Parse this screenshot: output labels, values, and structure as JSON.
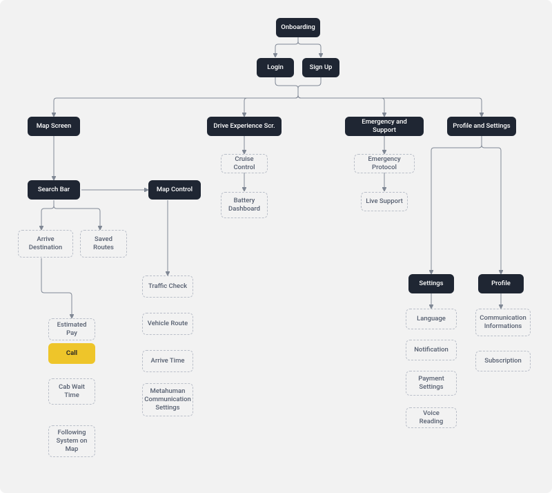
{
  "nodes": {
    "onboarding": "Onboarding",
    "login": "Login",
    "signup": "Sign Up",
    "mapScreen": "Map Screen",
    "driveExp": "Drive Experience Scr.",
    "emergency": "Emergency and Support",
    "profileSettings": "Profile and Settings",
    "cruiseControl": "Cruise Control",
    "batteryDashboard": "Battery Dashboard",
    "emergencyProtocol": "Emergency Protocol",
    "liveSupport": "Live Support",
    "searchBar": "Search Bar",
    "mapControl": "Map Control",
    "arriveDestination": "Arrive Destination",
    "savedRoutes": "Saved Routes",
    "estimatedPay": "Estimated Pay",
    "call": "Call",
    "cabWaitTime": "Cab Wait Time",
    "followingSystem": "Following System on Map",
    "trafficCheck": "Traffic Check",
    "vehicleRoute": "Vehicle Route",
    "arriveTime": "Arrive Time",
    "metahuman": "Metahuman Communication Settings",
    "settings": "Settings",
    "profile": "Profile",
    "language": "Language",
    "notification": "Notification",
    "paymentSettings": "Payment Settings",
    "voiceReading": "Voice Reading",
    "commInfo": "Communication Informations",
    "subscription": "Subscription"
  },
  "chart_data": {
    "type": "tree",
    "title": "",
    "node_styles": {
      "dark": {
        "fill": "#1f2633",
        "text": "#ffffff",
        "dashed": false
      },
      "dashed": {
        "fill": "none",
        "text": "#545d6e",
        "dashed": true
      },
      "yellow": {
        "fill": "#eec52a",
        "text": "#222222",
        "dashed": false
      }
    },
    "nodes": [
      {
        "id": "onboarding",
        "label": "Onboarding",
        "style": "dark"
      },
      {
        "id": "login",
        "label": "Login",
        "style": "dark"
      },
      {
        "id": "signup",
        "label": "Sign Up",
        "style": "dark"
      },
      {
        "id": "mapScreen",
        "label": "Map Screen",
        "style": "dark"
      },
      {
        "id": "driveExp",
        "label": "Drive Experience Scr.",
        "style": "dark"
      },
      {
        "id": "emergency",
        "label": "Emergency and Support",
        "style": "dark"
      },
      {
        "id": "profileSettings",
        "label": "Profile and Settings",
        "style": "dark"
      },
      {
        "id": "searchBar",
        "label": "Search Bar",
        "style": "dark"
      },
      {
        "id": "mapControl",
        "label": "Map Control",
        "style": "dark"
      },
      {
        "id": "settings",
        "label": "Settings",
        "style": "dark"
      },
      {
        "id": "profile",
        "label": "Profile",
        "style": "dark"
      },
      {
        "id": "cruiseControl",
        "label": "Cruise Control",
        "style": "dashed"
      },
      {
        "id": "batteryDashboard",
        "label": "Battery Dashboard",
        "style": "dashed"
      },
      {
        "id": "emergencyProtocol",
        "label": "Emergency Protocol",
        "style": "dashed"
      },
      {
        "id": "liveSupport",
        "label": "Live Support",
        "style": "dashed"
      },
      {
        "id": "arriveDestination",
        "label": "Arrive Destination",
        "style": "dashed"
      },
      {
        "id": "savedRoutes",
        "label": "Saved Routes",
        "style": "dashed"
      },
      {
        "id": "estimatedPay",
        "label": "Estimated Pay",
        "style": "dashed"
      },
      {
        "id": "call",
        "label": "Call",
        "style": "yellow"
      },
      {
        "id": "cabWaitTime",
        "label": "Cab Wait Time",
        "style": "dashed"
      },
      {
        "id": "followingSystem",
        "label": "Following System on Map",
        "style": "dashed"
      },
      {
        "id": "trafficCheck",
        "label": "Traffic Check",
        "style": "dashed"
      },
      {
        "id": "vehicleRoute",
        "label": "Vehicle Route",
        "style": "dashed"
      },
      {
        "id": "arriveTime",
        "label": "Arrive Time",
        "style": "dashed"
      },
      {
        "id": "metahuman",
        "label": "Metahuman Communication Settings",
        "style": "dashed"
      },
      {
        "id": "language",
        "label": "Language",
        "style": "dashed"
      },
      {
        "id": "notification",
        "label": "Notification",
        "style": "dashed"
      },
      {
        "id": "paymentSettings",
        "label": "Payment Settings",
        "style": "dashed"
      },
      {
        "id": "voiceReading",
        "label": "Voice Reading",
        "style": "dashed"
      },
      {
        "id": "commInfo",
        "label": "Communication Informations",
        "style": "dashed"
      },
      {
        "id": "subscription",
        "label": "Subscription",
        "style": "dashed"
      }
    ],
    "edges": [
      [
        "onboarding",
        "login"
      ],
      [
        "onboarding",
        "signup"
      ],
      [
        "login",
        "mapScreen"
      ],
      [
        "login",
        "driveExp"
      ],
      [
        "login",
        "emergency"
      ],
      [
        "login",
        "profileSettings"
      ],
      [
        "signup",
        "mapScreen"
      ],
      [
        "signup",
        "driveExp"
      ],
      [
        "signup",
        "emergency"
      ],
      [
        "signup",
        "profileSettings"
      ],
      [
        "mapScreen",
        "searchBar"
      ],
      [
        "searchBar",
        "mapControl"
      ],
      [
        "searchBar",
        "arriveDestination"
      ],
      [
        "searchBar",
        "savedRoutes"
      ],
      [
        "arriveDestination",
        "estimatedPay"
      ],
      [
        "estimatedPay",
        "call"
      ],
      [
        "call",
        "cabWaitTime"
      ],
      [
        "cabWaitTime",
        "followingSystem"
      ],
      [
        "mapControl",
        "trafficCheck"
      ],
      [
        "trafficCheck",
        "vehicleRoute"
      ],
      [
        "vehicleRoute",
        "arriveTime"
      ],
      [
        "arriveTime",
        "metahuman"
      ],
      [
        "driveExp",
        "cruiseControl"
      ],
      [
        "cruiseControl",
        "batteryDashboard"
      ],
      [
        "emergency",
        "emergencyProtocol"
      ],
      [
        "emergencyProtocol",
        "liveSupport"
      ],
      [
        "profileSettings",
        "settings"
      ],
      [
        "profileSettings",
        "profile"
      ],
      [
        "settings",
        "language"
      ],
      [
        "language",
        "notification"
      ],
      [
        "notification",
        "paymentSettings"
      ],
      [
        "paymentSettings",
        "voiceReading"
      ],
      [
        "profile",
        "commInfo"
      ],
      [
        "commInfo",
        "subscription"
      ]
    ]
  }
}
